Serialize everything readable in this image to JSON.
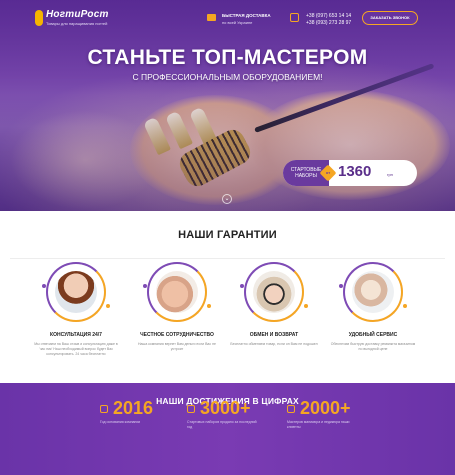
{
  "header": {
    "logo_name": "НогтиРост",
    "logo_tagline": "Товары для наращивания ногтей",
    "delivery_title": "БЫСТРАЯ ДОСТАВКА",
    "delivery_sub": "по всей Украине",
    "phone_1": "+38 (097) 653 14 14",
    "phone_2": "+38 (093) 273 28 97",
    "call_button": "ЗАКАЗАТЬ ЗВОНОК"
  },
  "hero": {
    "title": "СТАНЬТЕ ТОП-МАСТЕРОМ",
    "subtitle": "С ПРОФЕССИОНАЛЬНЫМ ОБОРУДОВАНИЕМ!",
    "price_label_1": "СТАРТОВЫЕ",
    "price_label_2": "НАБОРЫ",
    "price_badge": "от",
    "price_value": "1360",
    "price_currency": "грн",
    "scroll_icon": "chevron-down-icon"
  },
  "guarantees": {
    "title": "НАШИ ГАРАНТИИ",
    "items": [
      {
        "title": "КОНСУЛЬТАЦИЯ 24/7",
        "text": "Мы отвечаем на Ваш отзыв и консультацию даже в 'час пик' Наш необходимый вопрос будет Вас консультировать. 24 часа бесплатно"
      },
      {
        "title": "ЧЕСТНОЕ СОТРУДНИЧЕСТВО",
        "text": "Наша компания вернет Вам деньги если Вас не устроит"
      },
      {
        "title": "ОБМЕН И ВОЗВРАТ",
        "text": "Бесплатно обменяем товар, если он Вам не подошел"
      },
      {
        "title": "УДОБНЫЙ СЕРВИС",
        "text": "Обеспечим быструю доставку реквизита магазином по выгодной цене"
      }
    ]
  },
  "achievements": {
    "title": "НАШИ ДОСТИЖЕНИЯ В ЦИФРАХ",
    "items": [
      {
        "value": "2016",
        "text": "Год основания компании"
      },
      {
        "value": "3000+",
        "text": "Стартовых наборов продано за последний год"
      },
      {
        "value": "2000+",
        "text": "Мастеров маникюра и педикюра наши клиенты"
      }
    ]
  },
  "colors": {
    "brand_purple": "#7a3bb3",
    "accent_orange": "#f5a623"
  }
}
